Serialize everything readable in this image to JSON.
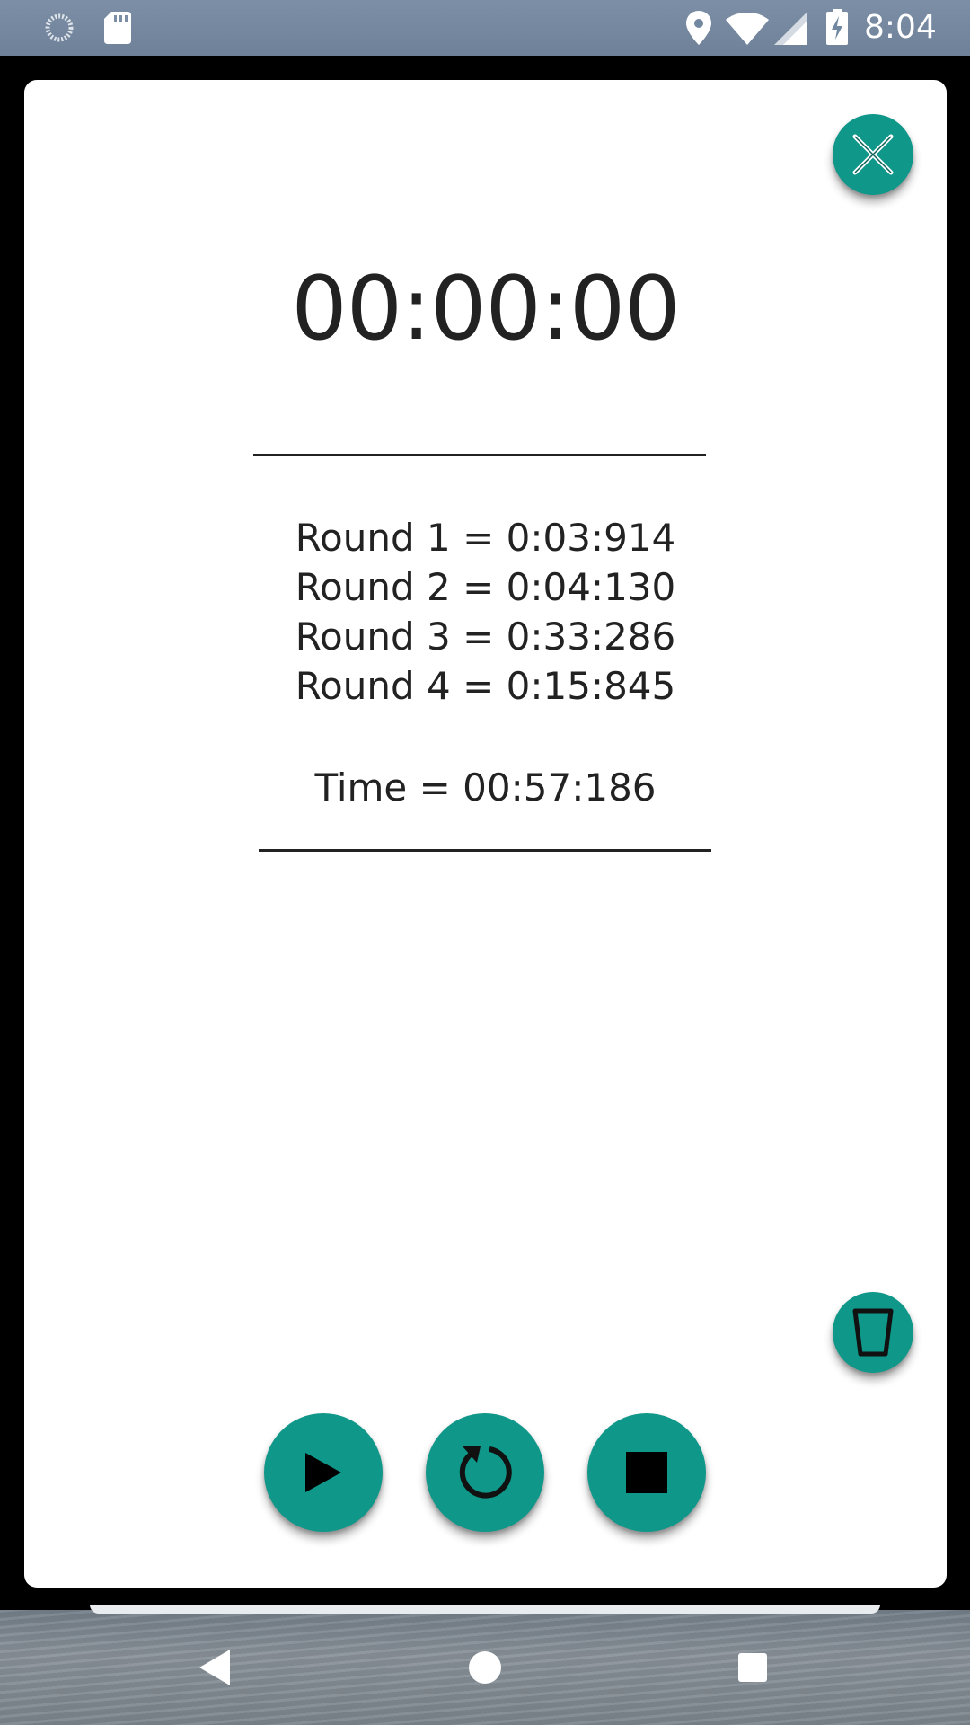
{
  "status_bar": {
    "time": "8:04",
    "icons": [
      "sync-icon",
      "sd-card-icon",
      "location-icon",
      "wifi-icon",
      "signal-icon",
      "battery-charging-icon"
    ]
  },
  "stopwatch": {
    "display": "00:00:00",
    "rounds": [
      "Round 1 = 0:03:914",
      "Round 2 = 0:04:130",
      "Round 3 = 0:33:286",
      "Round 4 = 0:15:845"
    ],
    "total": "Time = 00:57:186"
  },
  "buttons": {
    "close": "close-icon",
    "delete": "trash-icon",
    "play": "play-icon",
    "restart": "restart-icon",
    "stop": "stop-icon"
  },
  "navigation": {
    "icons": [
      "back-icon",
      "home-icon",
      "recents-icon"
    ]
  },
  "colors": {
    "accent": "#0f978a",
    "text": "#222222",
    "card": "#ffffff"
  }
}
